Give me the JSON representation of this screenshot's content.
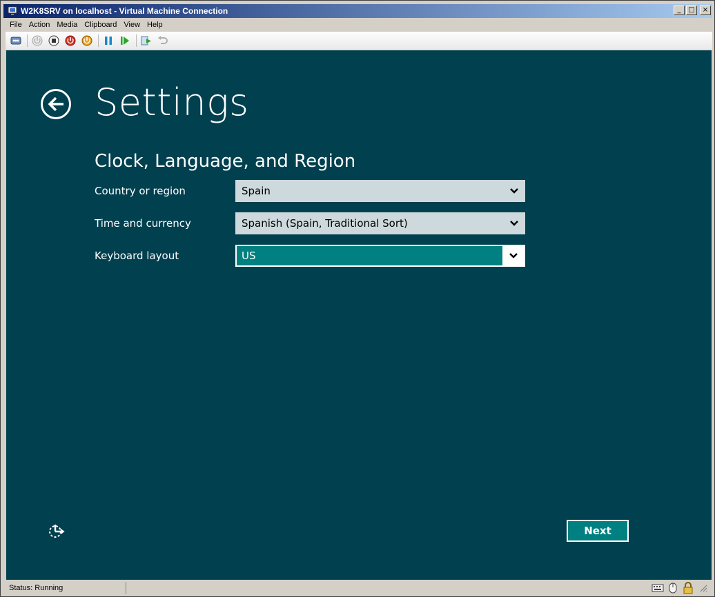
{
  "window": {
    "title": "W2K8SRV on localhost - Virtual Machine Connection",
    "minimize_glyph": "_",
    "maximize_glyph": "□",
    "close_glyph": "×"
  },
  "menubar": {
    "items": [
      "File",
      "Action",
      "Media",
      "Clipboard",
      "View",
      "Help"
    ]
  },
  "toolbar": {
    "icons": [
      "ctrl-alt-del-icon",
      "start-icon",
      "turn-off-icon",
      "shutdown-icon",
      "save-state-icon",
      "pause-icon",
      "reset-icon",
      "snapshot-icon",
      "revert-icon"
    ]
  },
  "setup": {
    "page_title": "Settings",
    "section_title": "Clock, Language, and Region",
    "fields": [
      {
        "label": "Country or region",
        "value": "Spain"
      },
      {
        "label": "Time and currency",
        "value": "Spanish (Spain, Traditional Sort)"
      },
      {
        "label": "Keyboard layout",
        "value": "US"
      }
    ],
    "next_label": "Next"
  },
  "status": {
    "text": "Status: Running"
  },
  "colors": {
    "screen_bg": "#00404f",
    "accent": "#008080",
    "select_bg": "#cdd9dd"
  }
}
